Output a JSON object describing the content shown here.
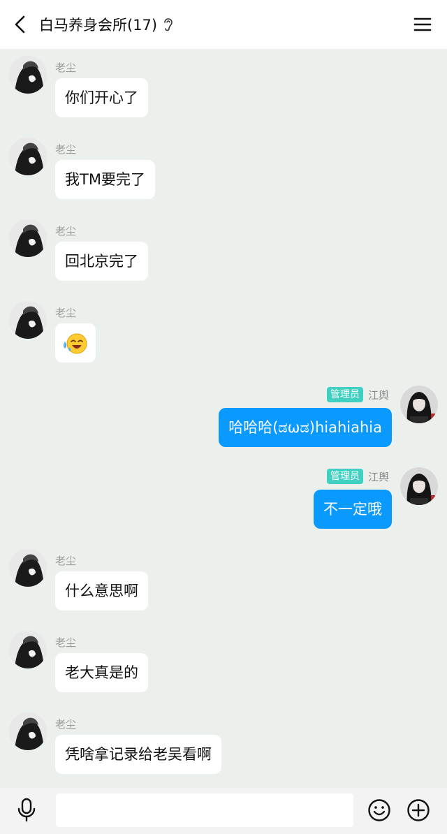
{
  "header": {
    "title": "白马养身会所(17)"
  },
  "messages": [
    {
      "side": "left",
      "sender": "老尘",
      "text": "你们开心了"
    },
    {
      "side": "left",
      "sender": "老尘",
      "text": "我TM要完了"
    },
    {
      "side": "left",
      "sender": "老尘",
      "text": "回北京完了"
    },
    {
      "side": "left",
      "sender": "老尘",
      "sticker": "crying-laughing-emoji"
    },
    {
      "side": "right",
      "sender": "江舆",
      "badge": "管理员",
      "text": "哈哈哈(ಡωಡ)hiahiahia"
    },
    {
      "side": "right",
      "sender": "江舆",
      "badge": "管理员",
      "text": "不一定哦"
    },
    {
      "side": "left",
      "sender": "老尘",
      "text": "什么意思啊"
    },
    {
      "side": "left",
      "sender": "老尘",
      "text": "老大真是的"
    },
    {
      "side": "left",
      "sender": "老尘",
      "text": "凭啥拿记录给老吴看啊"
    }
  ],
  "footer": {
    "input_value": "",
    "icons": [
      "microphone-icon",
      "emoji-icon",
      "plus-icon"
    ]
  },
  "colors": {
    "background": "#ecf0ec",
    "sent_bubble": "#0a99ff",
    "received_bubble": "#ffffff",
    "admin_badge": "#3fd0c2"
  }
}
